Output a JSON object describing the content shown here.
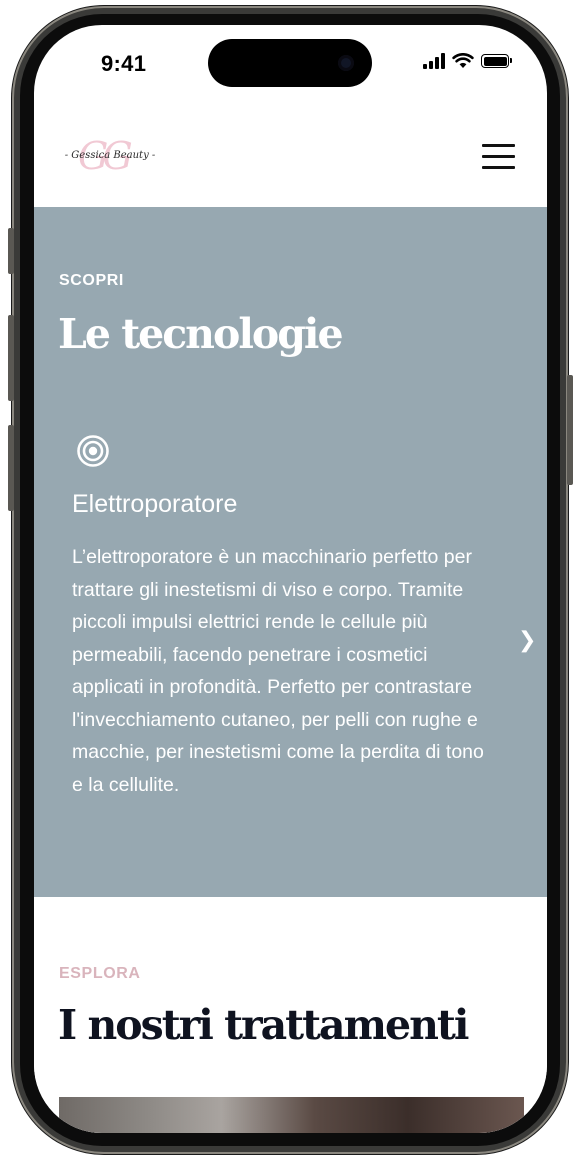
{
  "status_bar": {
    "time": "9:41"
  },
  "header": {
    "logo_monogram": "GG",
    "logo_text": "- Gessica Beauty -",
    "menu_icon": "hamburger-icon"
  },
  "technologies": {
    "eyebrow": "SCOPRI",
    "title": "Le tecnologie",
    "background": "#97a8b1",
    "card": {
      "icon": "target-icon",
      "title": "Elettroporatore",
      "description": "L’elettroporatore è un macchinario perfetto per trattare gli inestetismi di viso e corpo. Tramite piccoli impulsi elettrici rende le cellule più permeabili, facendo penetrare i cosmetici applicati in profondità. Perfetto per contrastare l'invecchiamento cutaneo, per pelli con rughe e macchie, per inestetismi come la perdita di tono e la cellulite."
    },
    "next_arrow": "❯"
  },
  "treatments": {
    "eyebrow": "ESPLORA",
    "title": "I nostri trattamenti",
    "eyebrow_color": "#d9b4bc"
  }
}
